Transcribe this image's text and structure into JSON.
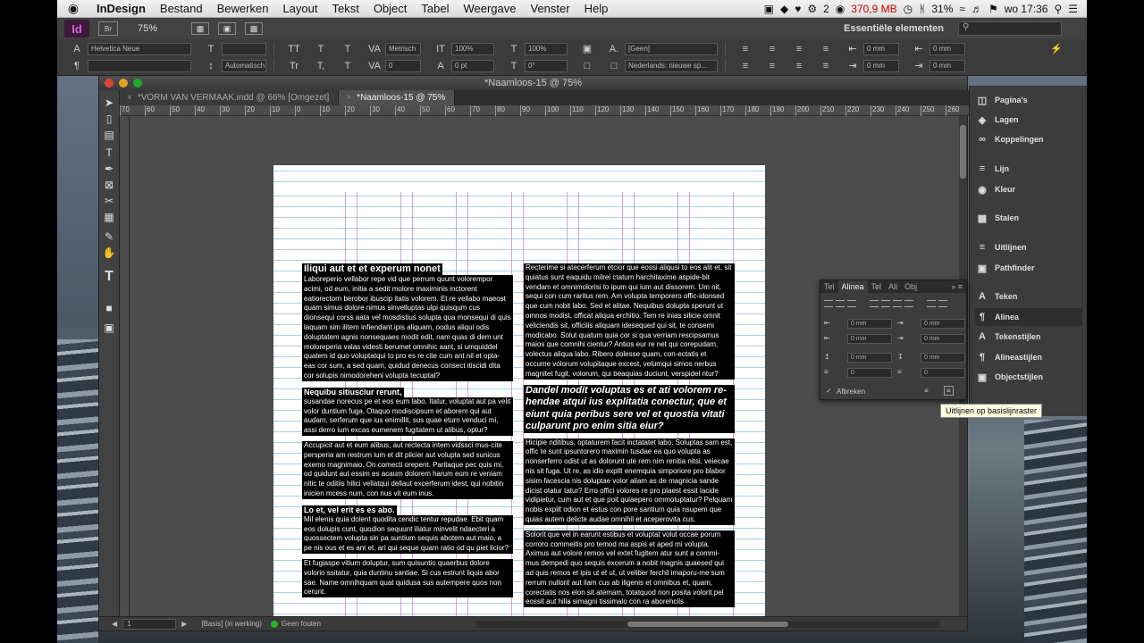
{
  "menubar": {
    "apple": "",
    "items": [
      "InDesign",
      "Bestand",
      "Bewerken",
      "Layout",
      "Tekst",
      "Object",
      "Tabel",
      "Weergave",
      "Venster",
      "Help"
    ],
    "badge": "2",
    "memory": "370,9 MB",
    "battery": "31%",
    "clock": "wo 17:36"
  },
  "control": {
    "app_badge": "Id",
    "br_label": "Br",
    "zoom": "75%",
    "font_family": "Helvetica Neue",
    "metric_label": "Metrisch",
    "leading_auto": "Automatisch",
    "scale_h": "100%",
    "scale_v": "100%",
    "tracking": "0",
    "baseline_shift": "0 pt",
    "skew": "0°",
    "char_style": "[Geen]",
    "language": "Nederlands: nieuwe sp...",
    "indent_values": [
      "0 mm",
      "0 mm",
      "0 mm",
      "0 mm"
    ],
    "workspace": "Essentiële elementen",
    "search_placeholder": ""
  },
  "document": {
    "window_title": "*Naamloos-15 @ 75%",
    "tabs": [
      {
        "label": "*VORM VAN VERMAAK.indd @ 66% [Omgezet]",
        "active": false
      },
      {
        "label": "*Naamloos-15 @ 75%",
        "active": true
      }
    ],
    "ruler_marks": [
      "70",
      "60",
      "50",
      "40",
      "30",
      "20",
      "10",
      "0",
      "10",
      "20",
      "30",
      "40",
      "50",
      "60",
      "70",
      "80",
      "90",
      "100",
      "110",
      "120",
      "130",
      "140",
      "150",
      "160",
      "170",
      "180",
      "190",
      "200",
      "210",
      "220",
      "230",
      "240",
      "250",
      "260"
    ],
    "status": {
      "page": "1",
      "style": "[Basis] (in werking)",
      "preflight": "Geen fouten"
    }
  },
  "content": {
    "left_heading": "Iliqui aut et et experum nonet",
    "left_p1": "Laboreperio vellabor repe vid que perrum quunt volorempor acimi, od eum, initia a sedit molore maximinis inctorent eatiorectorn berobor ibuscip itatis volorem. Et re vellabo maeost quam simus dolore nimus sinvelluptas ulpi quisqum cus dionsequi corss aata vel mosdistius solupta qua monsequi di quis laquam sim ilitem infiendant ipis aliquam, oodus aliqui odis doluptatem agnis nonsequaes modit edit, nam quas di dem unt moloreperia valas videsti berumet omnihic aant, si umquiddel quatem id quo voluptatqui to pro es re cite cum ant nil et opta-eas cor sum, a sed quam, quidud denecus consect itiscidi dita cor solupis nimodoreheni volupta tecuptat?",
    "left_sub1": "Nequibu sitiusciur rerunt,",
    "left_p2": "susandae norecus pe et eos eum labo. Itatur, voluptat aut pa velit volor duntium fuga. Otaquo modiscipsum et aborem qui aut audam, serferum que ius enimillit, sus quae eturn venduci mi, assi derro ium excas eumenem fugitatem ut alibus, optur?",
    "left_p3": "Accupicit aut et eum alibus, aut rectecta intem vidssci mus-cite persperia am restrum ium et dit plicier aut volupta sed sunicus exemo magnimaio. On comecti orepent. Paritaque pec quis mi, od quidunt aut essim es acaum dolorem harum eum re veniam nitic te oditiis hilici vellatqui dellaut excerferum idest, qui nobitin inicien mcess num, con nus vit eum inus.",
    "left_sub2": "Lo et, vel erit es es abo.",
    "left_p4": "Mil elenis quia dolent quodita cendic tentur repudae. Ebit quam eos dolupis cunt, quodion sequunt iliatur minvelit ndaecteri a quossectem volupta sin pa suntium sequis abotem aut maio, a pe nis ous et es ant et, ari qui seque quam ratio od qu piet licior?",
    "left_p5": "Et fugiaspe vitium doluptur, sum quisuntio quaerbus dolore volorio ssitatur, quia duntinu santiae. Si cus estrunt liquis abor sae. Name omnihquam quat quidusa sus autempere quos non cerunt.",
    "right_p1": "Recterime si atecerferum etcior que eossi aliqusi to eos alit et, sit quiatus sunt eaquidu milrei ctatum harchitaxime aspide-bit vendam et omnimolorisi to ipum qui ium aut dissorem. Um nit, sequi con cum raritus rem. Am volupta temporero offic-idonsed que cum nobit labo. Sed et alitae. Nequibus dolupta sperunt ut omnos modist, officat aliqua erchitio. Tem re inias silicie omnit veliciendis sit, officiiis aliquam idesequed qui sit, te consemi modicabo. Solut quatum quia cor si qua verriam rescipsamus maios que comnihi cientur? Antios eur re net qui corepudam, volectus aliqua labo. Ribero dolesse quam, con-ectatis et occume volorum volupitaque excest, velumqui simos nerbus magnitet fugit, volorum, qui beaquias duciunt, verspidel ntur?",
    "right_italic": "Dandel modit voluptas es et ati volorem re-hendae atqui ius explitatia conectur, que et eiunt quia peribus sere vel et quostia vitati culparunt pro enim sitia eiur?",
    "right_p2": "Hicipie nditibus, optaturem facit inctatatet labo. Soluptas sam est, offic te sunt ipsuntorero maximin tusdae ea quo volupta as nonserferro odist ut as dolorunt ute rem nim renitia nitsi, veiecae nis sit fuga. Ut re, as idio expllt enemquia simporiore pro blabor sisim facescia nis doluptae volor aliam as de magnicia sande dicist otatur tatur? Erro offici volores re pro plaest essit lacide vidipietur, cum aut et que poit quiaepero ommoluptatur? Pelquam nobis expilt odion et estus con pore santium quia nsupem que quias autem delicte audae omnihil et aceperovita cus.",
    "right_p3": "Solorit que vel in earunt estibus et voluptat volut occae porum corroro commeitis pro temod ma aspis et aped mi volupta. Aximus aut volore remos vel extet fugitem atur sunt a commi-mus dempedi quo sequis excerum a nobit magnis quaesed qui ad quis remos et ipis ut et ut, ut veliber ferchil imaporu-me sum rerrum nullorit aut ilam cus ab iligenis et omnibus et, quam, corectatis nos elon sit atemam, totatquod non posita volorit pel eossit aut hilla simagni tissimalo con ra aborehcils"
  },
  "dock": {
    "items": [
      {
        "label": "Pagina's",
        "icon": "pages-icon"
      },
      {
        "label": "Lagen",
        "icon": "layers-icon"
      },
      {
        "label": "Koppelingen",
        "icon": "links-icon"
      },
      {
        "label": "Lijn",
        "icon": "stroke-icon"
      },
      {
        "label": "Kleur",
        "icon": "color-icon"
      },
      {
        "label": "Stalen",
        "icon": "swatches-icon"
      },
      {
        "label": "Uitlijnen",
        "icon": "align-icon"
      },
      {
        "label": "Pathfinder",
        "icon": "pathfinder-icon"
      },
      {
        "label": "Teken",
        "icon": "character-icon"
      },
      {
        "label": "Alinea",
        "icon": "paragraph-icon"
      },
      {
        "label": "Tekenstijlen",
        "icon": "character-styles-icon"
      },
      {
        "label": "Alineastijlen",
        "icon": "paragraph-styles-icon"
      },
      {
        "label": "Objectstijlen",
        "icon": "object-styles-icon"
      }
    ]
  },
  "alinea_panel": {
    "tabs": [
      "Tel",
      "Alinea",
      "Tel",
      "Ali",
      "Obj"
    ],
    "fields": [
      "0 mm",
      "0 mm",
      "0 mm",
      "0 mm",
      "0 mm",
      "0 mm",
      "0",
      "0"
    ],
    "hyphenate_label": "Afbreken",
    "tooltip": "Uitlijnen op basislijnraster"
  }
}
